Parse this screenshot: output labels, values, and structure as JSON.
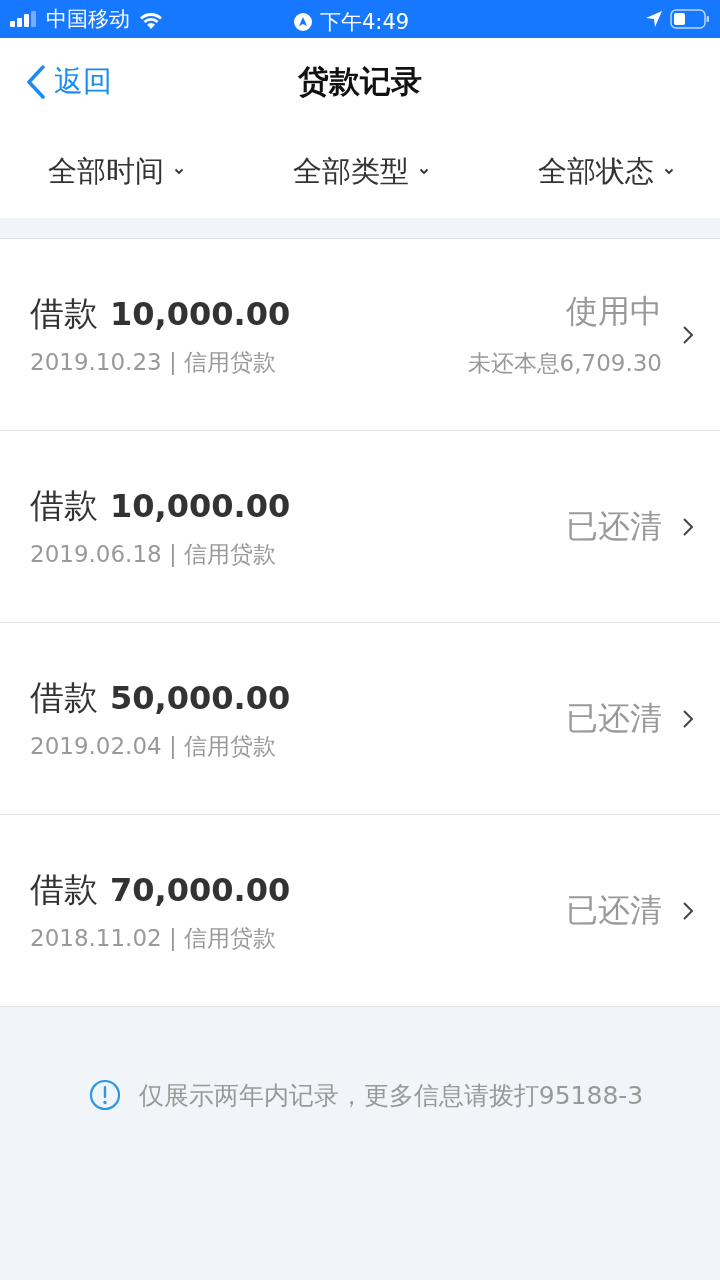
{
  "status_bar": {
    "carrier": "中国移动",
    "time": "下午4:49"
  },
  "nav": {
    "back": "返回",
    "title": "贷款记录"
  },
  "filters": [
    {
      "label": "全部时间"
    },
    {
      "label": "全部类型"
    },
    {
      "label": "全部状态"
    }
  ],
  "records": [
    {
      "title": "借款",
      "amount": "10,000.00",
      "subtitle": "2019.10.23 | 信用贷款",
      "status": "使用中",
      "remaining": "未还本息6,709.30"
    },
    {
      "title": "借款",
      "amount": "10,000.00",
      "subtitle": "2019.06.18 | 信用贷款",
      "status": "已还清"
    },
    {
      "title": "借款",
      "amount": "50,000.00",
      "subtitle": "2019.02.04 | 信用贷款",
      "status": "已还清"
    },
    {
      "title": "借款",
      "amount": "70,000.00",
      "subtitle": "2018.11.02 | 信用贷款",
      "status": "已还清"
    }
  ],
  "notice": "仅展示两年内记录，更多信息请拨打95188-3"
}
